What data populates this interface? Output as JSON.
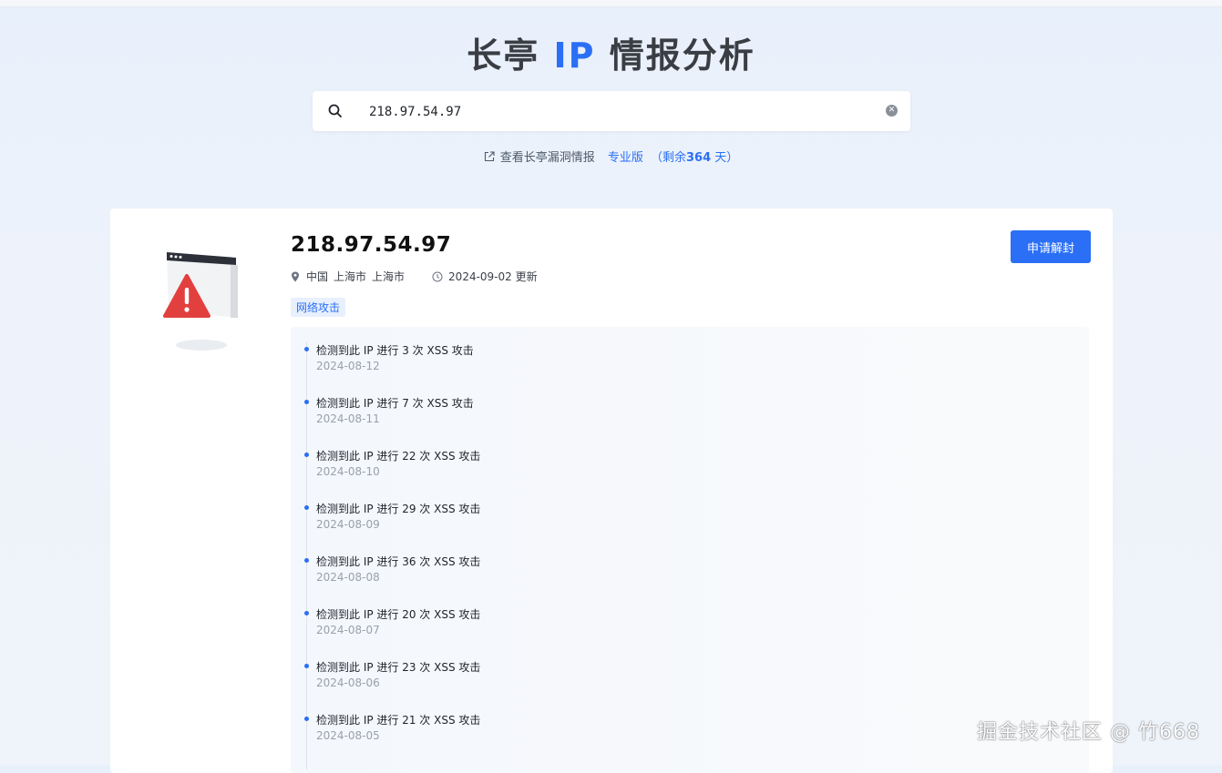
{
  "header": {
    "title_prefix": "长亭",
    "title_accent": "IP",
    "title_suffix": "情报分析"
  },
  "search": {
    "value": "218.97.54.97"
  },
  "subnav": {
    "link_label": "查看长亭漏洞情报",
    "pro_label": "专业版",
    "remain_open": "（剩余",
    "remain_days": "364",
    "remain_close": "天）"
  },
  "result": {
    "ip": "218.97.54.97",
    "location": {
      "country": "中国",
      "province": "上海市",
      "city": "上海市"
    },
    "updated": "2024-09-02 更新",
    "tag": "网络攻击",
    "unblock_label": "申请解封",
    "events": [
      {
        "text": "检测到此 IP 进行 3 次 XSS 攻击",
        "date": "2024-08-12"
      },
      {
        "text": "检测到此 IP 进行 7 次 XSS 攻击",
        "date": "2024-08-11"
      },
      {
        "text": "检测到此 IP 进行 22 次 XSS 攻击",
        "date": "2024-08-10"
      },
      {
        "text": "检测到此 IP 进行 29 次 XSS 攻击",
        "date": "2024-08-09"
      },
      {
        "text": "检测到此 IP 进行 36 次 XSS 攻击",
        "date": "2024-08-08"
      },
      {
        "text": "检测到此 IP 进行 20 次 XSS 攻击",
        "date": "2024-08-07"
      },
      {
        "text": "检测到此 IP 进行 23 次 XSS 攻击",
        "date": "2024-08-06"
      },
      {
        "text": "检测到此 IP 进行 21 次 XSS 攻击",
        "date": "2024-08-05"
      }
    ]
  },
  "watermark": "掘金技术社区 @ 竹668",
  "colors": {
    "accent": "#2a6ff5",
    "alert": "#e2403f"
  }
}
